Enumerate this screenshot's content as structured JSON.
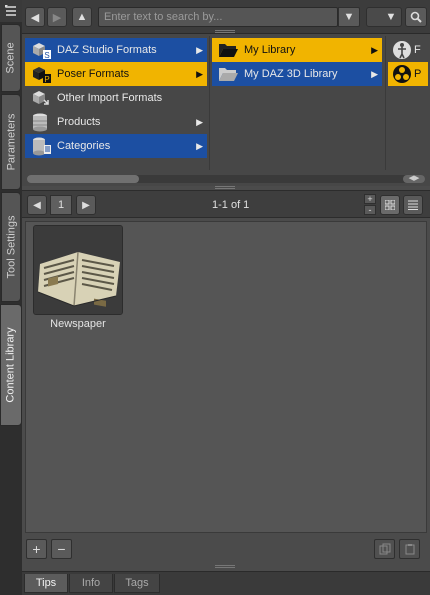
{
  "left_tabs": {
    "menu_icon": "list-menu-icon",
    "items": [
      "Scene",
      "Parameters",
      "Tool Settings",
      "Content Library"
    ],
    "active": "Content Library"
  },
  "toolbar": {
    "back_icon": "arrow-left-icon",
    "forward_icon": "arrow-right-icon",
    "up_icon": "arrow-up-icon",
    "search_placeholder": "Enter text to search by...",
    "filter_icon": "dropdown-filter-icon",
    "options_icon": "dropdown-options-icon",
    "search_icon": "magnifier-icon"
  },
  "tree": {
    "column1": [
      {
        "label": "DAZ Studio Formats",
        "icon": "daz-studio-formats-icon",
        "state": "blue",
        "arrow": "▶"
      },
      {
        "label": "Poser Formats",
        "icon": "poser-formats-icon",
        "state": "yellow",
        "arrow": "▶"
      },
      {
        "label": "Other Import Formats",
        "icon": "import-formats-icon",
        "state": "none",
        "arrow": ""
      },
      {
        "label": "Products",
        "icon": "products-icon",
        "state": "none",
        "arrow": "▶"
      },
      {
        "label": "Categories",
        "icon": "categories-icon",
        "state": "blue",
        "arrow": "▶"
      }
    ],
    "column2": [
      {
        "label": "My Library",
        "icon": "folder-open-icon",
        "state": "yellow",
        "arrow": "▶"
      },
      {
        "label": "My DAZ 3D Library",
        "icon": "folder-icon",
        "state": "blue",
        "arrow": "▶"
      }
    ],
    "column3": [
      {
        "label": "F",
        "icon": "figure-icon",
        "state": "none"
      },
      {
        "label": "P",
        "icon": "props-icon",
        "state": "yellow"
      }
    ]
  },
  "pager": {
    "page": "1",
    "range": "1-1 of 1",
    "zoom_in": "+",
    "zoom_out": "-",
    "icon_view": "icon-view-icon",
    "list_view": "list-view-icon"
  },
  "content": {
    "items": [
      {
        "label": "Newspaper",
        "thumbnail": "newspaper-thumbnail"
      }
    ]
  },
  "bottom": {
    "add": "+",
    "remove": "−"
  },
  "bottom_tabs": {
    "items": [
      "Tips",
      "Info",
      "Tags"
    ],
    "active": "Tips"
  },
  "colors": {
    "selected_blue": "#1c4fa2",
    "selected_yellow": "#f1b400"
  }
}
